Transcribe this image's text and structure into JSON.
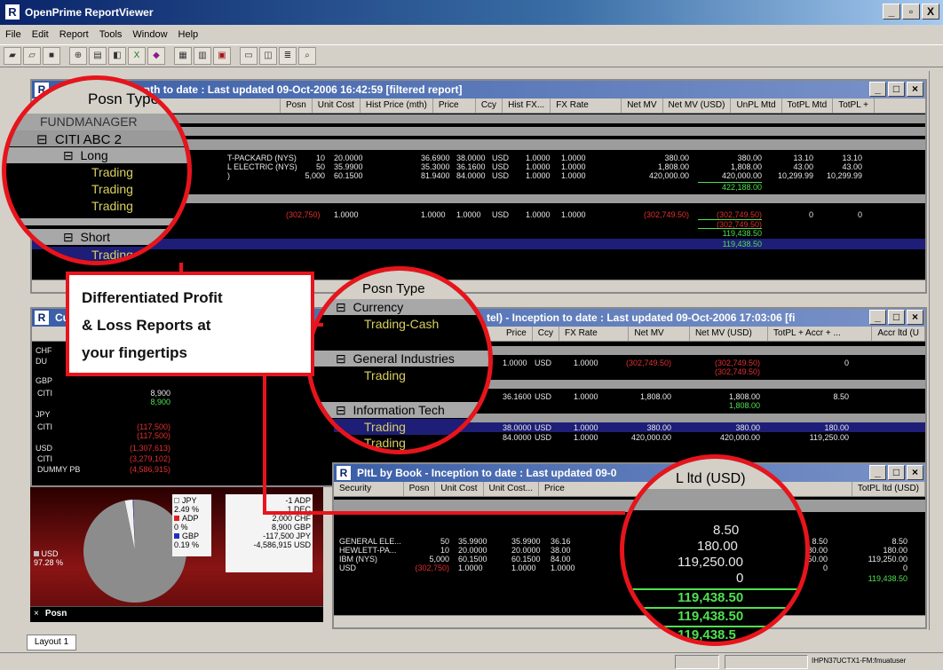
{
  "app": {
    "title": "OpenPrime ReportViewer",
    "logo": "R",
    "min": "_",
    "max": "ꟷ",
    "close": "X"
  },
  "menu": [
    "File",
    "Edit",
    "Report",
    "Tools",
    "Window",
    "Help"
  ],
  "toolbar_icons": [
    "open-icon",
    "folder-icon",
    "save-icon",
    "print-icon",
    "print-preview-icon",
    "export-icon",
    "excel-icon",
    "chart-icon",
    "layout-icon",
    "grid-icon",
    "filter-icon",
    "window-icon",
    "columns-icon",
    "find-icon"
  ],
  "win1": {
    "title": "Posn Type rt - Month to date : Last updated 09-Oct-2006 16:42:59 [filtered report]",
    "columns": [
      "urity",
      "Posn",
      "Unit Cost",
      "Hist Price (mth)",
      "Price",
      "Ccy",
      "Hist FX...",
      "FX Rate",
      "Net MV",
      "Net MV (USD)",
      "UnPL Mtd",
      "TotPL Mtd",
      "TotPL +"
    ],
    "rows": [
      {
        "sec": "T-PACKARD (NYS)",
        "posn": "10",
        "cost": "20.0000",
        "hist": "36.6900",
        "price": "38.0000",
        "ccy": "USD",
        "hfx": "1.0000",
        "fx": "1.0000",
        "mv": "380.00",
        "mvu": "380.00",
        "unpl": "13.10",
        "totpl": "13.10"
      },
      {
        "sec": "L ELECTRIC (NYS)",
        "posn": "50",
        "cost": "35.9900",
        "hist": "35.3000",
        "price": "36.1600",
        "ccy": "USD",
        "hfx": "1.0000",
        "fx": "1.0000",
        "mv": "1,808.00",
        "mvu": "1,808.00",
        "unpl": "43.00",
        "totpl": "43.00"
      },
      {
        "sec": ")",
        "posn": "5,000",
        "cost": "60.1500",
        "hist": "81.9400",
        "price": "84.0000",
        "ccy": "USD",
        "hfx": "1.0000",
        "fx": "1.0000",
        "mv": "420,000.00",
        "mvu": "420,000.00",
        "unpl": "10,299.99",
        "totpl": "10,299.99"
      }
    ],
    "sum1": "422,188.00",
    "short_row": {
      "posn": "(302,750)",
      "cost": "1.0000",
      "hist": "1.0000",
      "price": "1.0000",
      "ccy": "USD",
      "hfx": "1.0000",
      "fx": "1.0000",
      "mv": "(302,749.50)",
      "mvu": "(302,749.50)",
      "unpl": "0",
      "totpl": "0"
    },
    "sum2": "(302,749.50)",
    "sum3": "119,438.50",
    "sum4": "119,438.50"
  },
  "zoom1": {
    "header": "Posn Type",
    "fund": "FUNDMANAGER",
    "group": "CITI ABC 2",
    "long": "Long",
    "t1": "Trading",
    "t2": "Trading",
    "t3": "Trading",
    "short": "Short",
    "tc": "Trading-C"
  },
  "callout": {
    "l1": "Differentiated Profit",
    "l2": "& Loss Reports at",
    "l3": "your fingertips"
  },
  "win2": {
    "title": "Cu",
    "title_tail": "tel) - Inception to date : Last updated 09-Oct-2006 17:03:06 [fi",
    "columns": [
      "Price",
      "Ccy",
      "FX Rate",
      "Net MV",
      "Net MV (USD)",
      "TotPL + Accr + ...",
      "Accr ltd (U"
    ],
    "left_rows": [
      {
        "k": "CHF",
        "v": ""
      },
      {
        "k": "DU",
        "v": ""
      },
      {
        "k": "GBP",
        "v": ""
      },
      {
        "k": "CITI",
        "v": "8,900"
      },
      {
        "k": "",
        "v": "8,900"
      },
      {
        "k": "JPY",
        "v": ""
      },
      {
        "k": "CITI",
        "v": "(117,500)"
      },
      {
        "k": "",
        "v": "(117,500)"
      },
      {
        "k": "USD",
        "v": "(1,307,613)"
      },
      {
        "k": "CITI",
        "v": "(3,279,102)"
      },
      {
        "k": "DUMMY PB",
        "v": "(4,586,915)"
      }
    ],
    "r1": {
      "price": "1.0000",
      "ccy": "USD",
      "fx": "1.0000",
      "mv": "(302,749.50)",
      "mvu": "(302,749.50)",
      "tot": "0"
    },
    "r1sum": "(302,749.50)",
    "r2": {
      "price": "36.1600",
      "ccy": "USD",
      "fx": "1.0000",
      "mv": "1,808.00",
      "mvu": "1,808.00",
      "tot": "8.50"
    },
    "r2sum": "1,808.00",
    "r3": {
      "price": "38.0000",
      "ccy": "USD",
      "fx": "1.0000",
      "mv": "380.00",
      "mvu": "380.00",
      "tot": "180.00"
    },
    "r4": {
      "price": "84.0000",
      "ccy": "USD",
      "fx": "1.0000",
      "mv": "420,000.00",
      "mvu": "420,000.00",
      "tot": "119,250.00"
    }
  },
  "zoom2": {
    "header": "Posn Type",
    "g1": "Currency",
    "t1": "Trading-Cash",
    "g2": "General Industries",
    "t2": "Trading",
    "g3": "Information Tech",
    "t3": "Trading",
    "t4": "Trading"
  },
  "win3": {
    "title": "PItL by Book - Inception to date : Last updated 09-0",
    "title_tail": "L ltd (USD)",
    "columns": [
      "Security",
      "Posn",
      "Unit Cost",
      "Unit Cost...",
      "Price",
      "TotPL ltd (USD)",
      "TotPL ltd (USD)"
    ],
    "rows": [
      {
        "sec": "GENERAL ELE...",
        "posn": "50",
        "c1": "35.9900",
        "c2": "35.9900",
        "price": "36.16",
        "a": "8.50",
        "b": "8.50"
      },
      {
        "sec": "HEWLETT-PA...",
        "posn": "10",
        "c1": "20.0000",
        "c2": "20.0000",
        "price": "38.00",
        "a": "180.00",
        "b": "180.00"
      },
      {
        "sec": "IBM (NYS)",
        "posn": "5,000",
        "c1": "60.1500",
        "c2": "60.1500",
        "price": "84.00",
        "a": "119,250.00",
        "b": "119,250.00"
      },
      {
        "sec": "USD",
        "posn": "(302,750)",
        "c1": "1.0000",
        "c2": "1.0000",
        "price": "1.0000",
        "a": "0",
        "b": "0"
      }
    ],
    "sum": "119,438.50"
  },
  "zoom3": {
    "title": "L ltd (USD)",
    "v1": "8.50",
    "v2": "180.00",
    "v3": "119,250.00",
    "v4": "0",
    "s1": "119,438.50",
    "s2": "119,438.50",
    "s3": "119,438.5"
  },
  "pie": {
    "type": "pie",
    "slices": [
      {
        "name": "JPY",
        "pct": "2.49 %",
        "value": 2.49
      },
      {
        "name": "ADP",
        "pct": "0 %",
        "value": 0
      },
      {
        "name": "GBP",
        "pct": "0.19 %",
        "value": 0.19
      },
      {
        "name": "USD",
        "pct": "97.28 %",
        "value": 97.28
      }
    ],
    "legend": [
      "-1 ADP",
      "1 DEC",
      "2,000 CHF",
      "8,900 GBP",
      "-117,500 JPY",
      "-4,586,915 USD"
    ],
    "tab": "Posn"
  },
  "footer": {
    "layout_tab": "Layout 1",
    "status": "IHPN37UCTX1-FM:fmuatuser"
  }
}
